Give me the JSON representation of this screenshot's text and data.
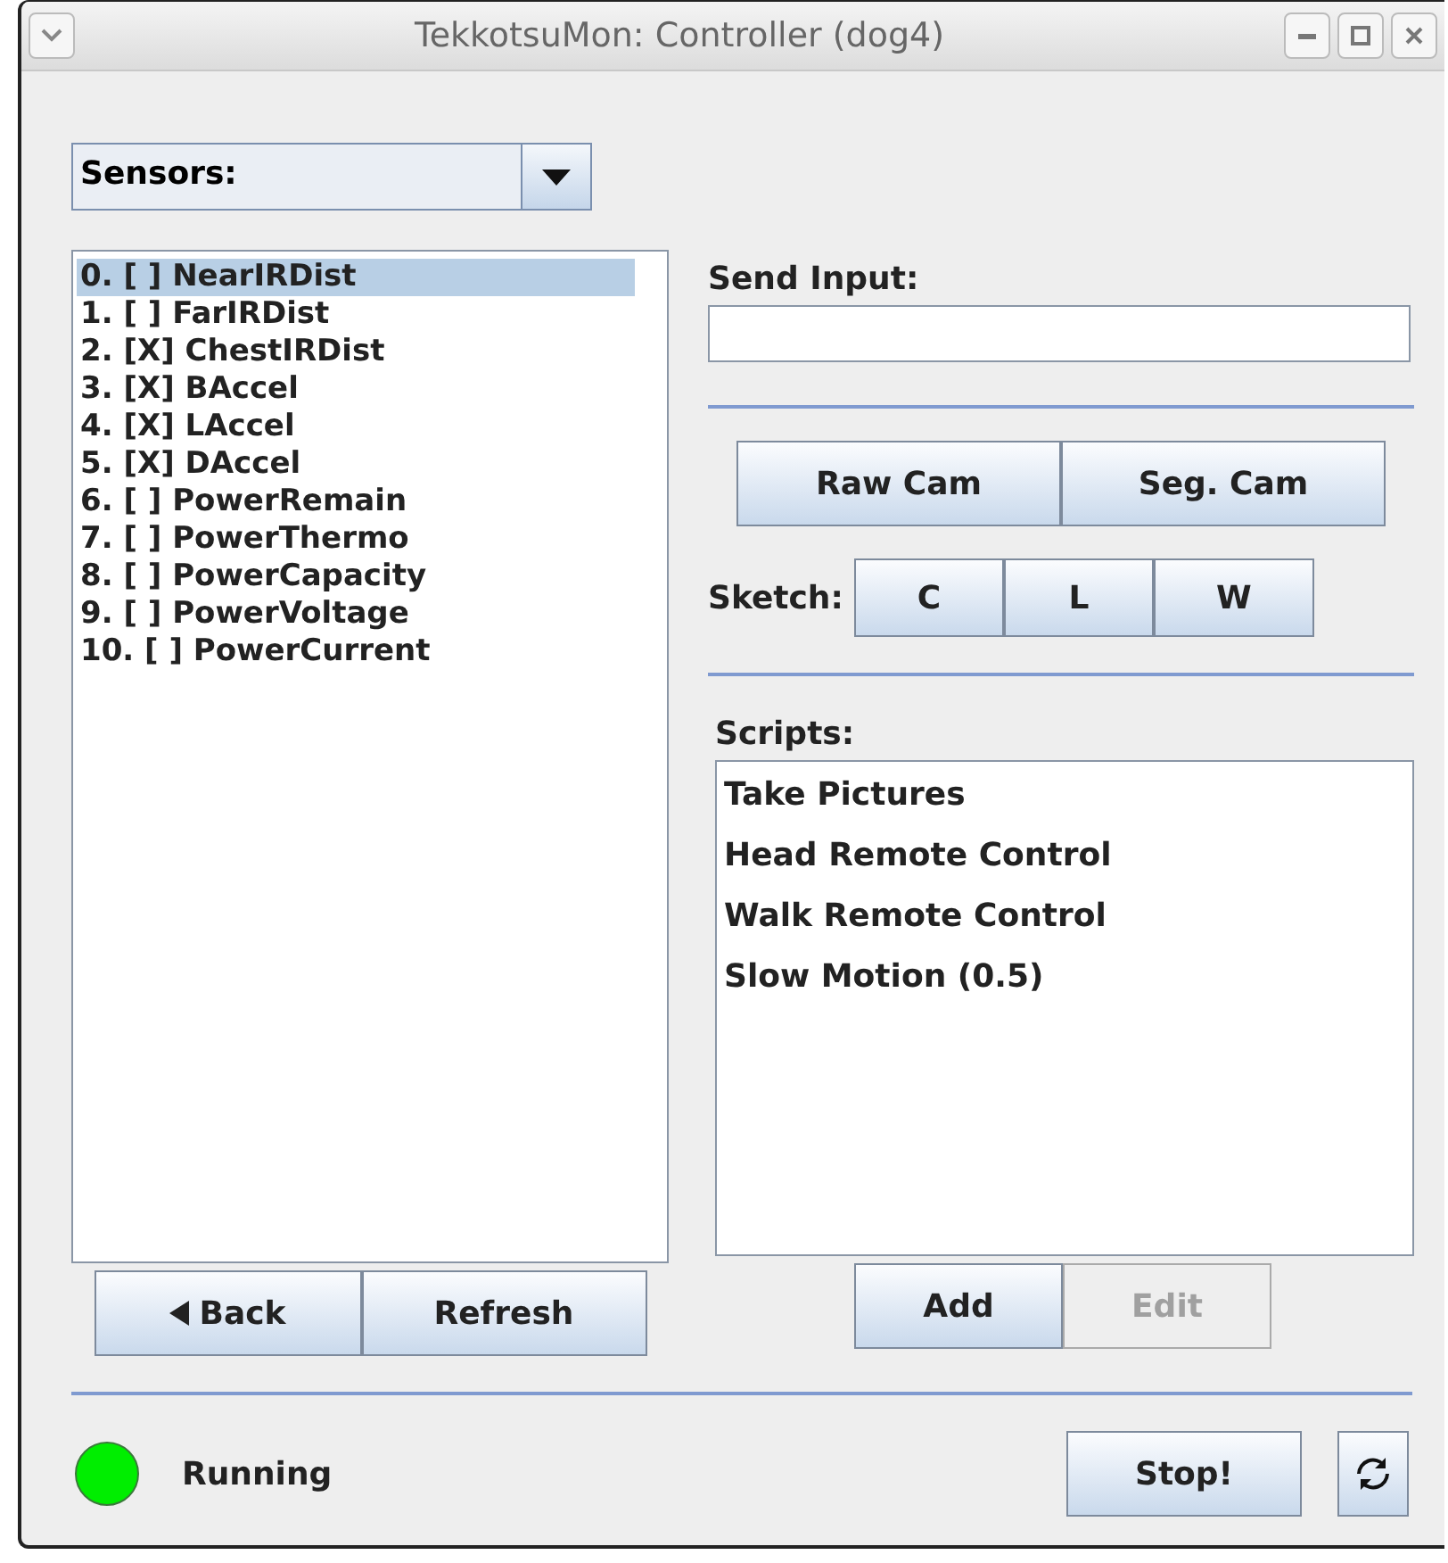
{
  "window": {
    "title": "TekkotsuMon: Controller (dog4)"
  },
  "menu_select": {
    "value": "Sensors:"
  },
  "sensor_list": [
    {
      "label": "0. [ ] NearIRDist",
      "selected": true
    },
    {
      "label": "1. [ ] FarIRDist",
      "selected": false
    },
    {
      "label": "2. [X] ChestIRDist",
      "selected": false
    },
    {
      "label": "3. [X] BAccel",
      "selected": false
    },
    {
      "label": "4. [X] LAccel",
      "selected": false
    },
    {
      "label": "5. [X] DAccel",
      "selected": false
    },
    {
      "label": "6. [ ] PowerRemain",
      "selected": false
    },
    {
      "label": "7. [ ] PowerThermo",
      "selected": false
    },
    {
      "label": "8. [ ] PowerCapacity",
      "selected": false
    },
    {
      "label": "9. [ ] PowerVoltage",
      "selected": false
    },
    {
      "label": "10. [ ] PowerCurrent",
      "selected": false
    }
  ],
  "list_buttons": [
    {
      "label": "Back",
      "kind": "back"
    },
    {
      "label": "Refresh",
      "kind": "plain"
    }
  ],
  "send_input": {
    "label": "Send Input:"
  },
  "camera_buttons": [
    "Raw Cam",
    "Seg. Cam"
  ],
  "sketch": {
    "label": "Sketch:",
    "buttons": [
      "C",
      "L",
      "W"
    ]
  },
  "scripts": {
    "label": "Scripts:",
    "items": [
      "Take Pictures",
      "Head Remote Control",
      "Walk Remote Control",
      "Slow Motion (0.5)"
    ],
    "buttons": [
      {
        "label": "Add",
        "disabled": false
      },
      {
        "label": "Edit",
        "disabled": true
      }
    ]
  },
  "status": {
    "text": "Running",
    "color": "#00ee00"
  },
  "stop_button": "Stop!"
}
